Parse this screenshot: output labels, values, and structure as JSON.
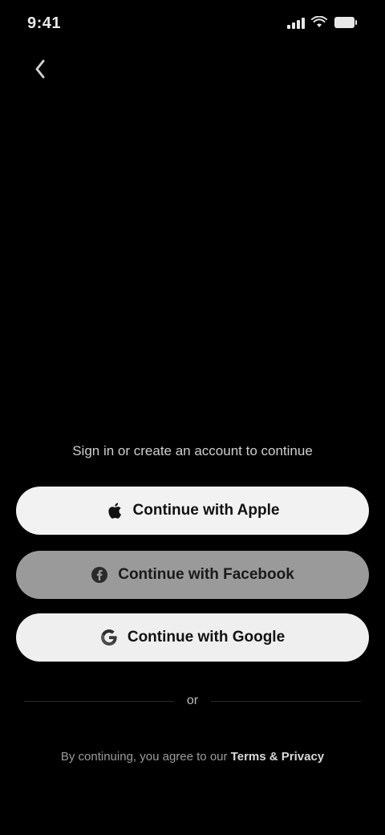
{
  "status_bar": {
    "time": "9:41",
    "battery_text": "100",
    "signal_icon": "signal-icon",
    "wifi_icon": "wifi-icon",
    "battery_icon": "battery-icon"
  },
  "header": {
    "back_icon": "chevron-left-icon"
  },
  "auth": {
    "prompt": "Sign in or create an account to continue",
    "apple_label": "Continue with Apple",
    "facebook_label": "Continue with Facebook",
    "google_label": "Continue with Google",
    "divider_label": "or",
    "footer_prefix": "By continuing, you agree to our",
    "footer_link": "Terms & Privacy"
  },
  "colors": {
    "background": "#000000",
    "button_light": "#f2f2f2",
    "button_gray": "#9a9a9a",
    "text_primary": "#e6e6e6",
    "text_muted": "#9c9c9c"
  }
}
